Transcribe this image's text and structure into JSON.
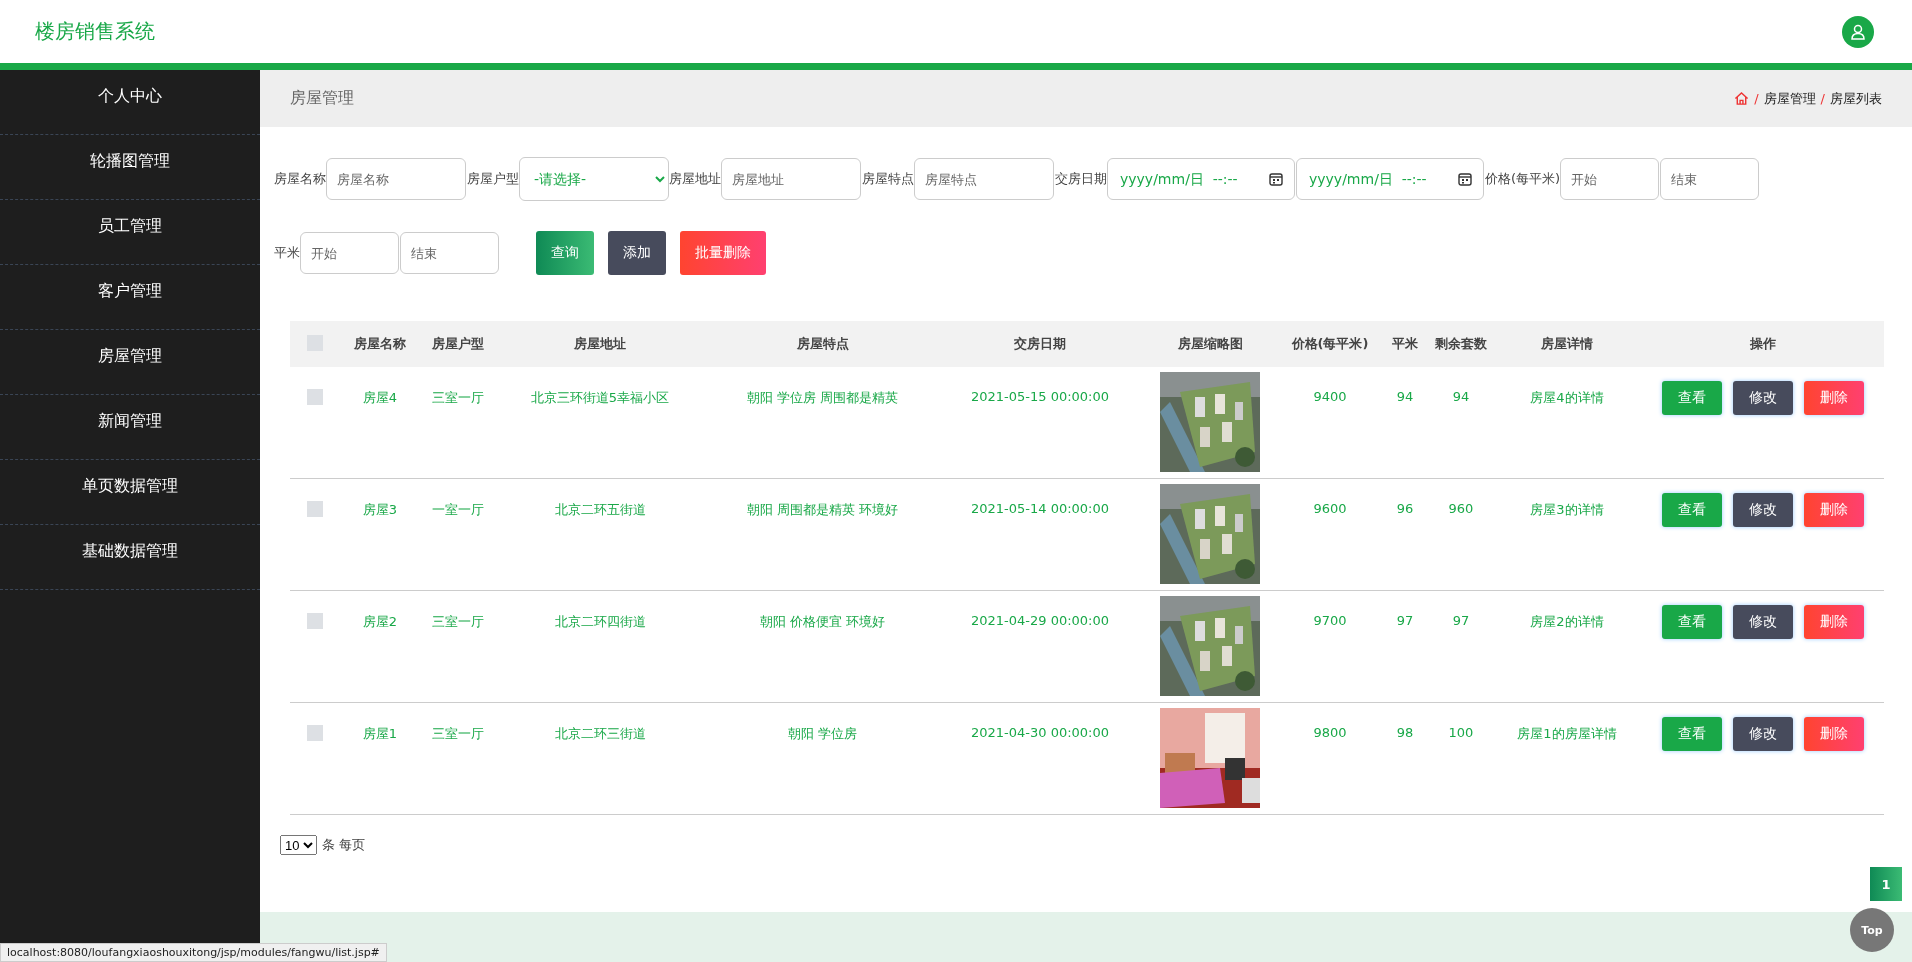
{
  "header": {
    "title": "楼房销售系统"
  },
  "sidebar": {
    "items": [
      {
        "label": "个人中心",
        "selected": false
      },
      {
        "label": "轮播图管理",
        "selected": false
      },
      {
        "label": "员工管理",
        "selected": false
      },
      {
        "label": "客户管理",
        "selected": false
      },
      {
        "label": "房屋管理",
        "selected": false
      },
      {
        "label": "新闻管理",
        "selected": false
      },
      {
        "label": "单页数据管理",
        "selected": false
      },
      {
        "label": "基础数据管理",
        "selected": false
      }
    ]
  },
  "page_title": "房屋管理",
  "breadcrumb": [
    {
      "separator": "/",
      "label": "房屋管理"
    },
    {
      "separator": "/",
      "label": "房屋列表"
    }
  ],
  "search": {
    "fields": [
      {
        "kind": "text",
        "label": "房屋名称",
        "placeholder": "房屋名称"
      },
      {
        "kind": "select",
        "label": "房屋户型",
        "value": "-请选择-"
      },
      {
        "kind": "text",
        "label": "房屋地址",
        "placeholder": "房屋地址"
      },
      {
        "kind": "text",
        "label": "房屋特点",
        "placeholder": "房屋特点"
      },
      {
        "kind": "range_date",
        "label": "交房日期",
        "placeholders": [
          "yyyy/mm/日  --:--",
          "yyyy/mm/日  --:--"
        ]
      },
      {
        "kind": "range",
        "label": "价格(每平米)",
        "placeholders": [
          "开始",
          "结束"
        ]
      },
      {
        "kind": "range",
        "label": "平米",
        "placeholders": [
          "开始",
          "结束"
        ]
      }
    ],
    "buttons": [
      {
        "kind": "search",
        "label": "查询"
      },
      {
        "kind": "add",
        "label": "添加"
      },
      {
        "kind": "delete",
        "label": "批量删除"
      }
    ]
  },
  "table": {
    "header_checked": false,
    "columns": [
      "房屋名称",
      "房屋户型",
      "房屋地址",
      "房屋特点",
      "交房日期",
      "房屋缩略图",
      "价格(每平米)",
      "平米",
      "剩余套数",
      "房屋详情",
      "操作"
    ],
    "rows": [
      {
        "checked": false,
        "cells": [
          "房屋4",
          "三室一厅",
          "北京三环街道5幸福小区",
          "朝阳 学位房 周围都是精英",
          "2021-05-15 00:00:00",
          {
            "kind": "picture"
          },
          "9400",
          "94",
          "94",
          "房屋4的详情",
          {
            "kind": "actions",
            "buttons": [
              "查看",
              "修改",
              "删除"
            ]
          }
        ]
      },
      {
        "checked": false,
        "cells": [
          "房屋3",
          "一室一厅",
          "北京二环五街道",
          "朝阳 周围都是精英 环境好",
          "2021-05-14 00:00:00",
          {
            "kind": "picture"
          },
          "9600",
          "96",
          "960",
          "房屋3的详情",
          {
            "kind": "actions",
            "buttons": [
              "查看",
              "修改",
              "删除"
            ]
          }
        ]
      },
      {
        "checked": false,
        "cells": [
          "房屋2",
          "三室一厅",
          "北京二环四街道",
          "朝阳 价格便宜 环境好",
          "2021-04-29 00:00:00",
          {
            "kind": "picture"
          },
          "9700",
          "97",
          "97",
          "房屋2的详情",
          {
            "kind": "actions",
            "buttons": [
              "查看",
              "修改",
              "删除"
            ]
          }
        ]
      },
      {
        "checked": false,
        "cells": [
          "房屋1",
          "三室一厅",
          "北京二环三街道",
          "朝阳 学位房",
          "2021-04-30 00:00:00",
          {
            "kind": "picture"
          },
          "9800",
          "98",
          "100",
          "房屋1的房屋详情",
          {
            "kind": "actions",
            "buttons": [
              "查看",
              "修改",
              "删除"
            ]
          }
        ]
      }
    ]
  },
  "pager": {
    "page_size": "10",
    "page_size_label": "条 每页",
    "pages": [
      {
        "label": "1",
        "selected": true
      }
    ]
  },
  "top_button": "Top",
  "status_bar": "localhost:8080/loufangxiaoshouxitong/jsp/modules/fangwu/list.jsp#"
}
